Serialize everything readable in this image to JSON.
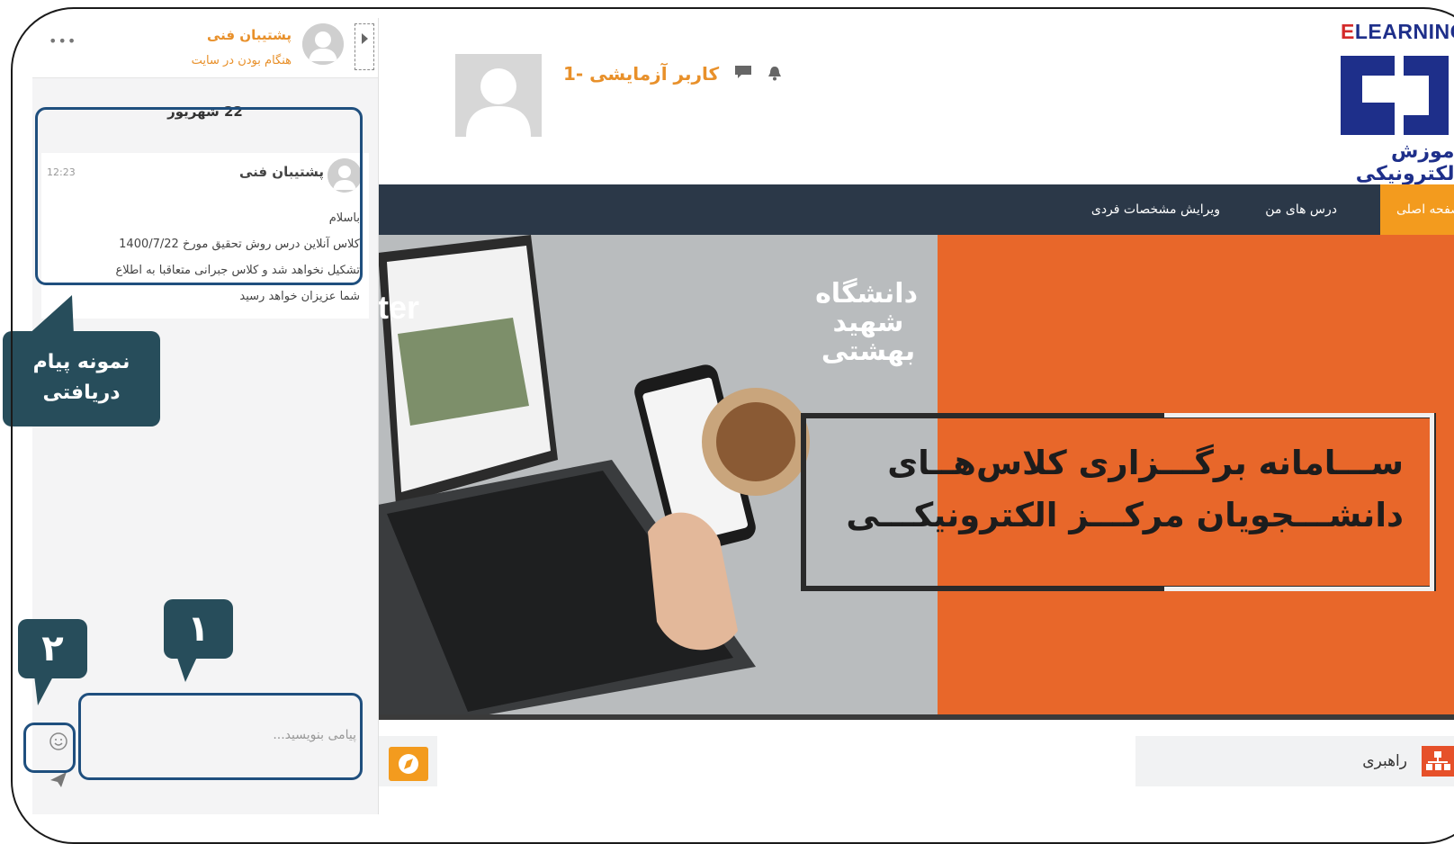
{
  "site": {
    "brand_text": "ELEARNING",
    "brand_fa": "آموزش الکترونیکی",
    "user_name": "کاربر آزمایشی -1",
    "colors": {
      "accent": "#f39b1e",
      "navbar": "#2b3848",
      "banner_orange": "#e8672a",
      "annotation": "#274d5b",
      "highlight": "#1f4f7e"
    }
  },
  "nav": {
    "home": "صفحه اصلی",
    "my_courses": "درس های من",
    "edit_profile": "ویرایش مشخصات فردی"
  },
  "banner": {
    "line1": "ســـامانه برگـــزاری کلاس‌هــای",
    "line2": "دانشـــجویان مرکـــز الکترونیکـــی",
    "university": "دانشگاه شهید بهشتی",
    "laptop_text": "ter"
  },
  "footer": {
    "guide_label": "راهبری",
    "guide_icon": "sitemap-icon",
    "compass_icon": "compass-icon"
  },
  "chat": {
    "contact_name": "پشتیبان فنی",
    "contact_status": "هنگام بودن در سایت",
    "menu_dots": "•••",
    "date": "22 شهریور",
    "message": {
      "sender": "پشتیبان فنی",
      "time": "12:23",
      "line1": "باسلام",
      "line2": "کلاس آنلاین درس روش تحقیق مورخ 1400/7/22",
      "line3": "تشکیل نخواهد شد و کلاس جبرانی متعاقبا به اطلاع",
      "line4": "شما عزیزان خواهد رسید"
    },
    "input_placeholder": "پیامی بنویسید...",
    "emoji_icon": "smiley-icon",
    "send_icon": "paper-plane-icon"
  },
  "annotations": {
    "received_message": "نمونه پیام دریافتی",
    "label_1": "۱",
    "label_2": "۲"
  }
}
